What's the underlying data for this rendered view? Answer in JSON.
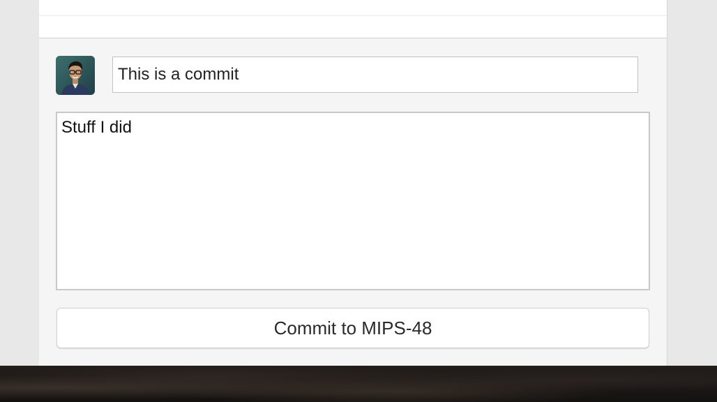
{
  "commit": {
    "summary_value": "This is a commit",
    "description_value": "Stuff I did",
    "button_label": "Commit to MIPS-48"
  },
  "avatar": {
    "icon": "user-avatar-photo"
  }
}
